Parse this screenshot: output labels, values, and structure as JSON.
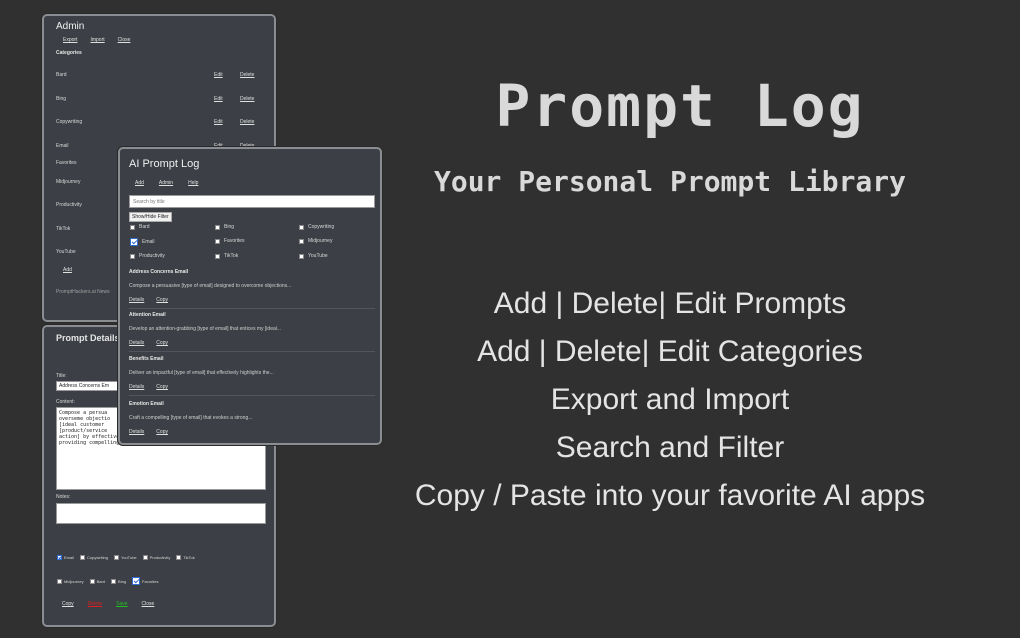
{
  "hero": {
    "title": "Prompt Log",
    "subtitle": "Your Personal Prompt Library",
    "features": [
      "Add | Delete| Edit Prompts",
      "Add | Delete| Edit Categories",
      "Export and Import",
      "Search and Filter",
      "Copy / Paste into your favorite AI apps"
    ]
  },
  "admin": {
    "title": "Admin",
    "links": [
      "Export",
      "Import",
      "Close"
    ],
    "categories_heading": "Categories",
    "edit_label": "Edit",
    "delete_label": "Delete",
    "categories": [
      "Bard",
      "Bing",
      "Copywriting",
      "Email",
      "Favorites",
      "Midjourney",
      "Productivity",
      "TikTok",
      "YouTube"
    ],
    "add_label": "Add",
    "footer": "PromptHackers.ai News"
  },
  "details": {
    "title": "Prompt Details",
    "title_label": "Title:",
    "title_value": "Address Concerns Em",
    "content_label": "Content:",
    "content_value": "Compose a persua\noverseme objectio\n[ideal customer \n[product/service\naction] by effectively addressing their doubts and\nproviding compelling reasons to move forward.",
    "notes_label": "Notes:",
    "checks_row1": [
      {
        "label": "Email",
        "checked": true
      },
      {
        "label": "Copywriting",
        "checked": false
      },
      {
        "label": "YouTube",
        "checked": false
      },
      {
        "label": "Productivity",
        "checked": false
      },
      {
        "label": "TikTok",
        "checked": false
      }
    ],
    "checks_row2": [
      {
        "label": "Midjourney",
        "checked": false
      },
      {
        "label": "Bard",
        "checked": false
      },
      {
        "label": "Bing",
        "checked": false
      },
      {
        "label": "Favorites",
        "checked": true
      }
    ],
    "copy_label": "Copy",
    "delete_label": "Delete",
    "save_label": "Save",
    "close_label": "Close"
  },
  "log": {
    "title": "AI Prompt Log",
    "links": [
      "Add",
      "Admin",
      "Help"
    ],
    "search_placeholder": "Search by title",
    "filter_button": "Show/Hide Filter",
    "filters": [
      {
        "label": "Bard",
        "checked": false
      },
      {
        "label": "Bing",
        "checked": false
      },
      {
        "label": "Copywriting",
        "checked": false
      },
      {
        "label": "Email",
        "checked": true
      },
      {
        "label": "Favorites",
        "checked": false
      },
      {
        "label": "Midjourney",
        "checked": false
      },
      {
        "label": "Productivity",
        "checked": false
      },
      {
        "label": "TikTok",
        "checked": false
      },
      {
        "label": "YouTube",
        "checked": false
      }
    ],
    "details_label": "Details",
    "copy_label": "Copy",
    "entries": [
      {
        "title": "Address Concerns Email",
        "desc": "Compose a persuasive [type of email] designed to overcome objections..."
      },
      {
        "title": "Attention Email",
        "desc": "Develop an attention-grabbing [type of email] that entices my [ideal..."
      },
      {
        "title": "Benefits Email",
        "desc": "Deliver an impactful [type of email] that effectively highlights the..."
      },
      {
        "title": "Emotion Email",
        "desc": "Craft a compelling [type of email] that evokes a strong..."
      }
    ]
  }
}
